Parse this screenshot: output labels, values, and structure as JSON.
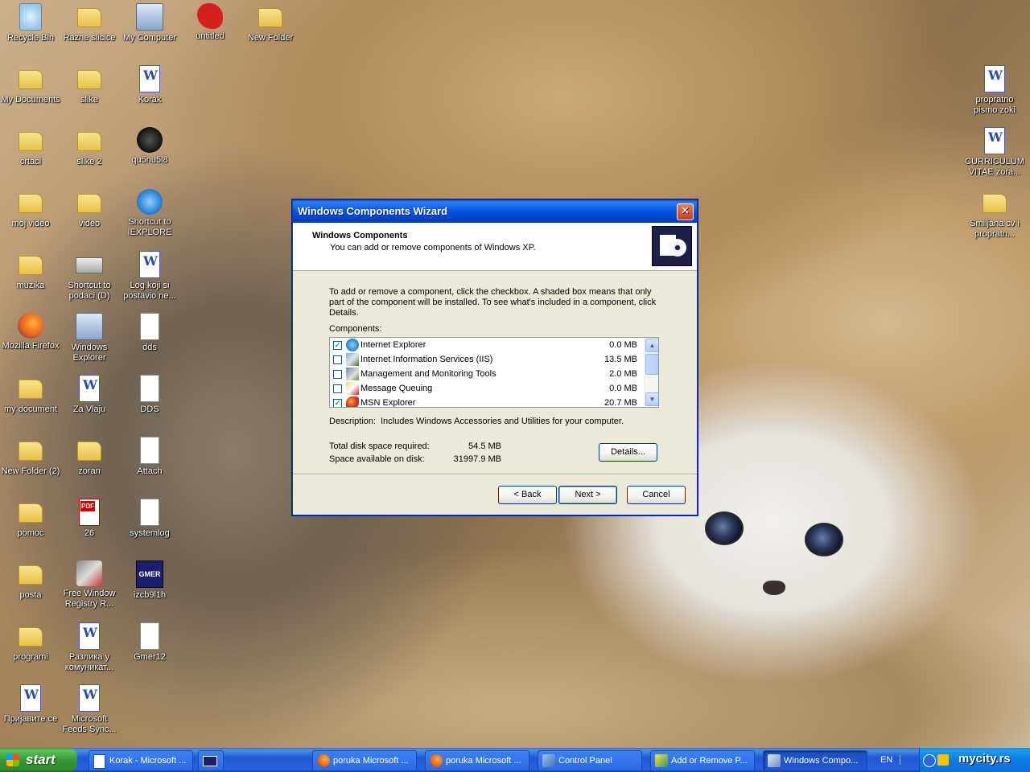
{
  "desktop": {
    "icons": [
      {
        "label": "Recycle Bin",
        "icon": "recycle-bin-icon"
      },
      {
        "label": "Razne slicice",
        "icon": "folder-icon"
      },
      {
        "label": "My Computer",
        "icon": "my-computer-icon"
      },
      {
        "label": "untitled",
        "icon": "paint-splat-icon"
      },
      {
        "label": "New Folder",
        "icon": "folder-icon"
      },
      {
        "label": "My Documents",
        "icon": "my-documents-icon"
      },
      {
        "label": "slike",
        "icon": "folder-icon"
      },
      {
        "label": "Korak",
        "icon": "word-document-icon"
      },
      {
        "label": "crtaci",
        "icon": "folder-icon"
      },
      {
        "label": "slike 2",
        "icon": "folder-icon"
      },
      {
        "label": "qu5nu5l8",
        "icon": "bug-icon"
      },
      {
        "label": "moj video",
        "icon": "folder-icon"
      },
      {
        "label": "video",
        "icon": "folder-icon"
      },
      {
        "label": "Shortcut to IEXPLORE",
        "icon": "internet-explorer-icon"
      },
      {
        "label": "muzika",
        "icon": "folder-icon"
      },
      {
        "label": "Shortcut to podaci (D)",
        "icon": "drive-icon"
      },
      {
        "label": "Log koji si postavio ne...",
        "icon": "word-document-icon"
      },
      {
        "label": "Mozilla Firefox",
        "icon": "firefox-icon"
      },
      {
        "label": "Windows Explorer",
        "icon": "windows-explorer-icon"
      },
      {
        "label": "dds",
        "icon": "document-icon"
      },
      {
        "label": "my document",
        "icon": "folder-icon"
      },
      {
        "label": "Za Vlaju",
        "icon": "word-document-icon"
      },
      {
        "label": "DDS",
        "icon": "document-icon"
      },
      {
        "label": "New Folder (2)",
        "icon": "folder-icon"
      },
      {
        "label": "zoran",
        "icon": "folder-icon"
      },
      {
        "label": "Attach",
        "icon": "document-icon"
      },
      {
        "label": "pomoc",
        "icon": "folder-icon"
      },
      {
        "label": "26",
        "icon": "pdf-icon"
      },
      {
        "label": "systemlog",
        "icon": "document-icon"
      },
      {
        "label": "posta",
        "icon": "folder-icon"
      },
      {
        "label": "Free Window Registry R...",
        "icon": "tools-icon"
      },
      {
        "label": "izcb9l1h",
        "icon": "gmer-icon"
      },
      {
        "label": "programi",
        "icon": "folder-icon"
      },
      {
        "label": "Разлика у комуникат...",
        "icon": "word-document-icon"
      },
      {
        "label": "Gmer12",
        "icon": "document-icon"
      },
      {
        "label": "Пријавите се",
        "icon": "word-document-icon"
      },
      {
        "label": "Microsoft Feeds Sync...",
        "icon": "word-document-icon"
      },
      {
        "label": "propratno pismo zoki",
        "icon": "word-document-icon"
      },
      {
        "label": "CURRICULUM VITAE zora...",
        "icon": "word-document-icon"
      },
      {
        "label": "Smiljana cv i propratn...",
        "icon": "folder-icon"
      }
    ]
  },
  "wizard": {
    "title": "Windows Components Wizard",
    "header_title": "Windows Components",
    "header_subtitle": "You can add or remove components of Windows XP.",
    "intro": "To add or remove a component, click the checkbox.  A shaded box means that only part of the component will be installed.  To see what's included in a component, click Details.",
    "components_label": "Components:",
    "components": [
      {
        "name": "Internet Explorer",
        "size": "0.0 MB",
        "checked": true
      },
      {
        "name": "Internet Information Services (IIS)",
        "size": "13.5 MB",
        "checked": false
      },
      {
        "name": "Management and Monitoring Tools",
        "size": "2.0 MB",
        "checked": false
      },
      {
        "name": "Message Queuing",
        "size": "0.0 MB",
        "checked": false
      },
      {
        "name": "MSN Explorer",
        "size": "20.7 MB",
        "checked": true
      }
    ],
    "description_label": "Description:",
    "description": "Includes Windows Accessories and Utilities for your computer.",
    "total_label": "Total disk space required:",
    "total_value": "54.5 MB",
    "available_label": "Space available on disk:",
    "available_value": "31997.9 MB",
    "details_button": "Details...",
    "back_button": "< Back",
    "next_button": "Next >",
    "cancel_button": "Cancel",
    "close_glyph": "✕"
  },
  "taskbar": {
    "start_label": "start",
    "tasks": [
      {
        "label": "Korak - Microsoft ...",
        "icon": "word-icon",
        "active": false
      },
      {
        "label": "",
        "icon": "gmer-icon",
        "active": false
      },
      {
        "label": "poruka Microsoft ...",
        "icon": "firefox-icon",
        "active": false
      },
      {
        "label": "poruka Microsoft ...",
        "icon": "firefox-icon",
        "active": false
      },
      {
        "label": "Control Panel",
        "icon": "control-panel-icon",
        "active": false
      },
      {
        "label": "Add or Remove P...",
        "icon": "add-remove-programs-icon",
        "active": false
      },
      {
        "label": "Windows Compo...",
        "icon": "windows-components-icon",
        "active": true
      }
    ],
    "language": "EN",
    "watermark": "mycity.rs"
  }
}
